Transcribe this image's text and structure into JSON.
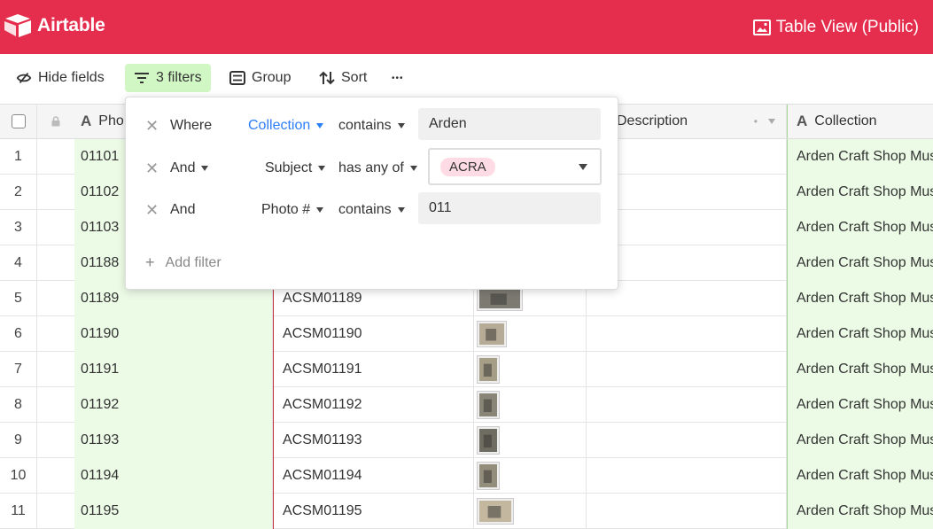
{
  "app": {
    "logo_text": "Airtable",
    "view_title": "Table View (Public)",
    "brand_color": "#e52e4d"
  },
  "toolbar": {
    "hide_fields": "Hide fields",
    "filters": "3 filters",
    "group": "Group",
    "sort": "Sort",
    "more": "•••"
  },
  "columns": {
    "photo": "Pho",
    "description": "Description",
    "collection": "Collection"
  },
  "rows": [
    {
      "num": "1",
      "photo": "01101",
      "id": "",
      "collection": "Arden Craft Shop Mus"
    },
    {
      "num": "2",
      "photo": "01102",
      "id": "",
      "collection": "Arden Craft Shop Mus"
    },
    {
      "num": "3",
      "photo": "01103",
      "id": "",
      "collection": "Arden Craft Shop Mus"
    },
    {
      "num": "4",
      "photo": "01188",
      "id": "",
      "collection": "Arden Craft Shop Mus"
    },
    {
      "num": "5",
      "photo": "01189",
      "id": "ACSM01189",
      "collection": "Arden Craft Shop Mus"
    },
    {
      "num": "6",
      "photo": "01190",
      "id": "ACSM01190",
      "collection": "Arden Craft Shop Mus"
    },
    {
      "num": "7",
      "photo": "01191",
      "id": "ACSM01191",
      "collection": "Arden Craft Shop Mus"
    },
    {
      "num": "8",
      "photo": "01192",
      "id": "ACSM01192",
      "collection": "Arden Craft Shop Mus"
    },
    {
      "num": "9",
      "photo": "01193",
      "id": "ACSM01193",
      "collection": "Arden Craft Shop Mus"
    },
    {
      "num": "10",
      "photo": "01194",
      "id": "ACSM01194",
      "collection": "Arden Craft Shop Mus"
    },
    {
      "num": "11",
      "photo": "01195",
      "id": "ACSM01195",
      "collection": "Arden Craft Shop Mus"
    }
  ],
  "filters": {
    "items": [
      {
        "conj": "Where",
        "field": "Collection",
        "op": "contains",
        "value": "Arden"
      },
      {
        "conj": "And",
        "field": "Subject",
        "op": "has any of",
        "value": "ACRA"
      },
      {
        "conj": "And",
        "field": "Photo #",
        "op": "contains",
        "value": "011"
      }
    ],
    "add_label": "Add filter",
    "remove_glyph": "✕",
    "plus_glyph": "+"
  }
}
